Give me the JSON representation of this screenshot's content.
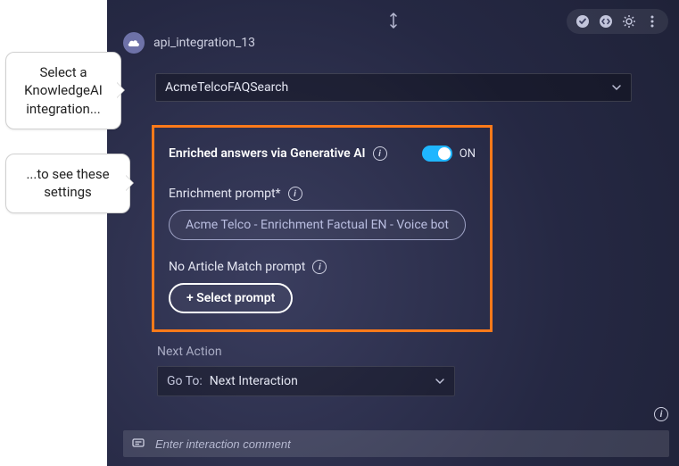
{
  "header": {
    "interaction_name": "api_integration_13"
  },
  "integration_select": {
    "value": "AcmeTelcoFAQSearch"
  },
  "generative_panel": {
    "title": "Enriched answers via Generative AI",
    "toggle_state": "ON",
    "enrichment_prompt_label": "Enrichment prompt*",
    "enrichment_prompt_value": "Acme Telco - Enrichment Factual EN - Voice bot",
    "no_match_label": "No Article Match prompt",
    "select_prompt_button": "+ Select prompt"
  },
  "next_action": {
    "label": "Next Action",
    "prefix": "Go To:",
    "value": "Next Interaction"
  },
  "comment": {
    "placeholder": "Enter interaction comment"
  },
  "callouts": {
    "c1": "Select a KnowledgeAI integration...",
    "c2": "...to see these settings"
  }
}
